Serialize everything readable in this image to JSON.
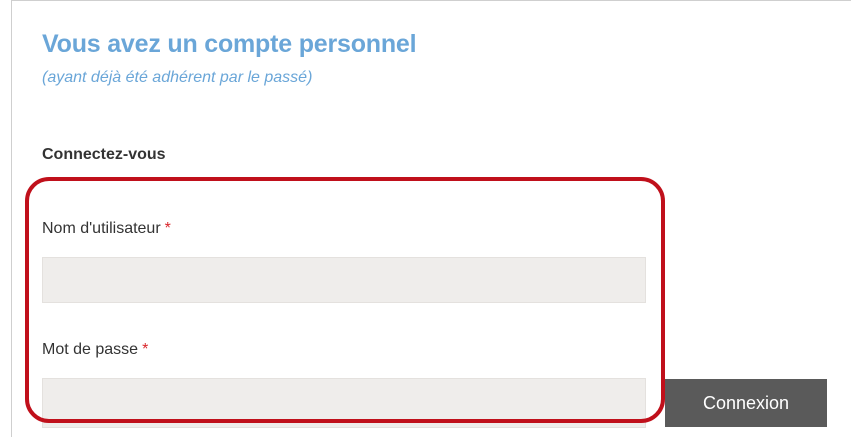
{
  "header": {
    "title": "Vous avez un compte personnel",
    "subtitle": "(ayant déjà été adhérent par le passé)"
  },
  "login": {
    "heading": "Connectez-vous",
    "username": {
      "label": "Nom d'utilisateur",
      "required_mark": "*",
      "value": ""
    },
    "password": {
      "label": "Mot de passe",
      "required_mark": "*",
      "value": ""
    },
    "submit_label": "Connexion"
  },
  "colors": {
    "title": "#6aa6d8",
    "required": "#d9262b",
    "highlight": "#c0101b",
    "button": "#5a5a5a",
    "field_bg": "#efedeb"
  }
}
